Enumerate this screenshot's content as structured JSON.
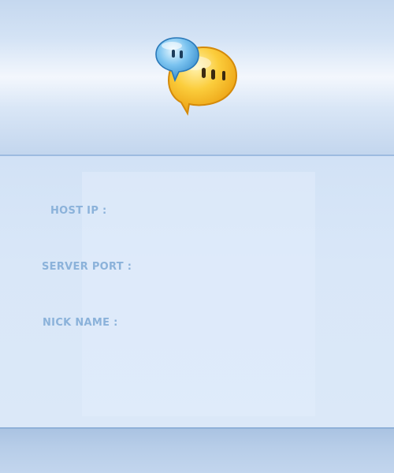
{
  "app": {
    "logo_icon": "chat-bubbles-icon"
  },
  "form": {
    "host_ip_label": "HOST IP :",
    "server_port_label": "SERVER PORT :",
    "nick_name_label": "NICK NAME :"
  },
  "colors": {
    "label_text": "#8bb2da",
    "header_band": "#c5d8ef",
    "form_background": "#dbe8f8",
    "footer_band": "#b7cde8",
    "logo_yellow": "#f7b81c",
    "logo_blue": "#5aaee6"
  }
}
